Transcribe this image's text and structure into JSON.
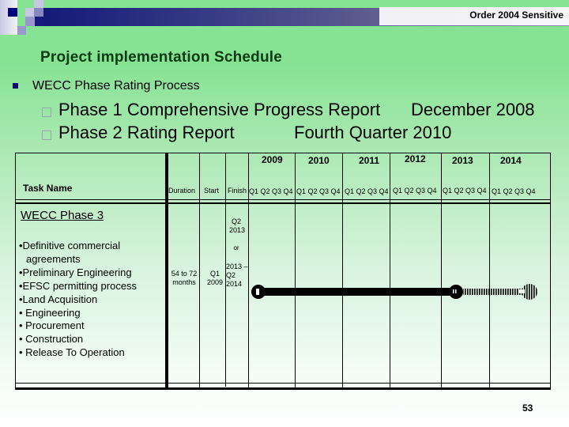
{
  "header": {
    "sensitivity_label": "Order 2004 Sensitive"
  },
  "slide": {
    "title": "Project implementation Schedule",
    "bullet": "WECC Phase Rating Process",
    "sub_bullets": [
      {
        "label": "Phase 1 Comprehensive Progress Report",
        "timing": "December 2008"
      },
      {
        "label": "Phase 2 Rating Report",
        "timing": "Fourth Quarter 2010"
      }
    ],
    "page_number": "53"
  },
  "gantt": {
    "columns": {
      "task_name": "Task Name",
      "duration": "Duration",
      "start": "Start",
      "finish": "Finish"
    },
    "years": [
      "2009",
      "2010",
      "2011",
      "2012",
      "2013",
      "2014"
    ],
    "quarters_label": "Q1 Q2 Q3 Q4",
    "task": {
      "name": "WECC Phase 3",
      "subtasks": [
        "•Definitive commercial",
        "  agreements",
        "•Preliminary Engineering",
        "•EFSC permitting process",
        "•Land Acquisition",
        "• Engineering",
        "• Procurement",
        "• Construction",
        "• Release To Operation"
      ],
      "duration": [
        "54 to 72",
        "months"
      ],
      "start": [
        "Q1",
        "2009"
      ],
      "finish_line1": [
        "Q2",
        "2013"
      ],
      "finish_or": "or",
      "finish_line2": [
        "2013 –",
        "Q2",
        "2014"
      ],
      "bar": {
        "start_quarter": "Q1 2009",
        "solid_end_quarter": "Q2 2013",
        "extended_end_quarter": "Q2 2014"
      }
    }
  }
}
